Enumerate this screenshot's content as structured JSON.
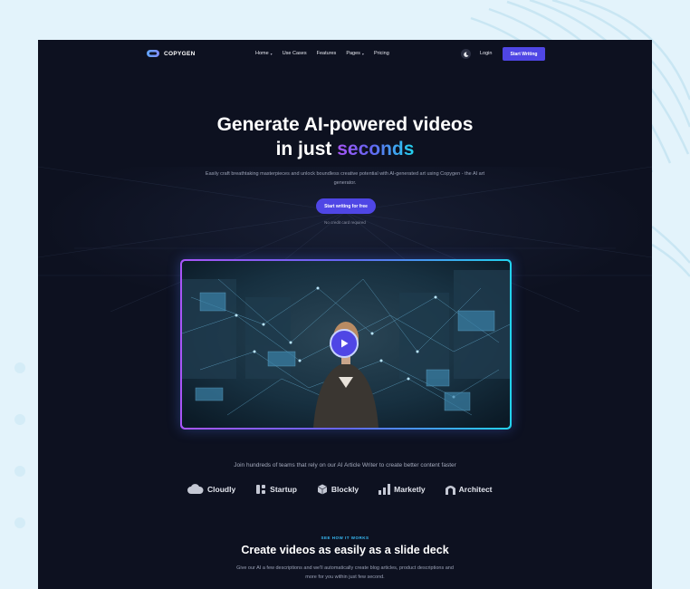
{
  "brand": {
    "name": "COPYGEN"
  },
  "nav": {
    "items": [
      {
        "label": "Home",
        "has_dropdown": true
      },
      {
        "label": "Use Cases",
        "has_dropdown": false
      },
      {
        "label": "Features",
        "has_dropdown": false
      },
      {
        "label": "Pages",
        "has_dropdown": true
      },
      {
        "label": "Pricing",
        "has_dropdown": false
      }
    ],
    "login": "Login",
    "start_button": "Start Writing",
    "theme_icon": "moon-icon"
  },
  "hero": {
    "title_line1": "Generate AI-powered videos",
    "title_line2_prefix": "in just ",
    "title_highlight": "seconds",
    "subtitle": "Easily craft breathtaking masterpieces and unlock boundless creative potential with AI-generated art using Copygen - the AI art generator.",
    "cta": "Start writing for free",
    "note": "No credit card required"
  },
  "video": {
    "play_icon": "play-icon"
  },
  "teams": {
    "heading": "Join hundreds of teams that rely on our AI Article Writer to create better content faster",
    "brands": [
      "Cloudly",
      "Startup",
      "Blockly",
      "Marketly",
      "Architect"
    ]
  },
  "how_it_works": {
    "eyebrow": "SEE HOW IT WORKS",
    "title": "Create videos as easily as a slide deck",
    "subtitle": "Give our AI a few descriptions and we'll automatically create blog articles, product descriptions and more for you within just few second."
  },
  "colors": {
    "background": "#e3f3fb",
    "panel": "#0d1120",
    "accent": "#4f46e5",
    "gradient_start": "#a855f7",
    "gradient_end": "#22d3ee",
    "eyebrow": "#38bdf8"
  }
}
